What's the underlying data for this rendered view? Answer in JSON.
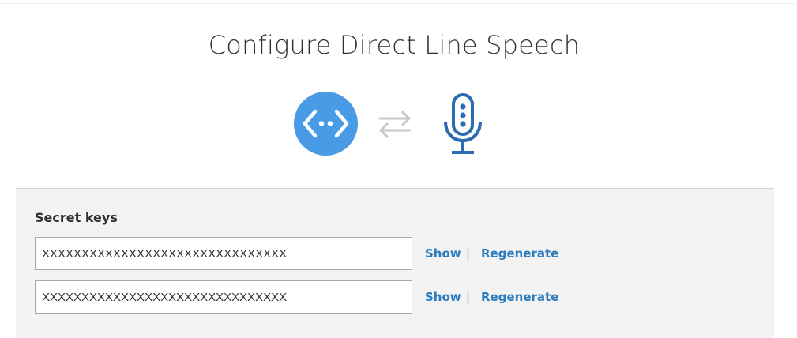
{
  "header": {
    "title": "Configure Direct Line Speech"
  },
  "icons": {
    "bot": "bot-channel-icon",
    "swap": "swap-arrows-icon",
    "mic": "microphone-icon",
    "accent_color": "#4a9be5",
    "mic_color": "#2b6bb0",
    "swap_color": "#c8c8c8"
  },
  "secret_keys": {
    "label": "Secret keys",
    "separator": "|",
    "rows": [
      {
        "value": "XXXXXXXXXXXXXXXXXXXXXXXXXXXXXXX",
        "show_label": "Show",
        "regenerate_label": "Regenerate"
      },
      {
        "value": "XXXXXXXXXXXXXXXXXXXXXXXXXXXXXXX",
        "show_label": "Show",
        "regenerate_label": "Regenerate"
      }
    ]
  }
}
